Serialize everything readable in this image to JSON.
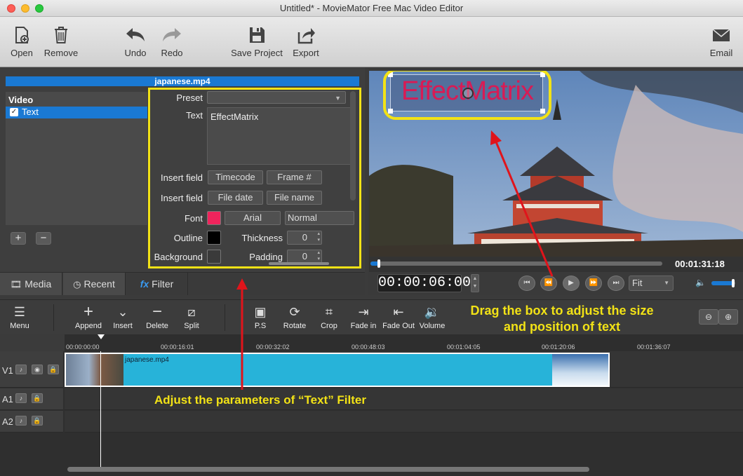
{
  "window": {
    "title": "Untitled* - MovieMator Free Mac Video Editor"
  },
  "toolbar": {
    "open": "Open",
    "remove": "Remove",
    "undo": "Undo",
    "redo": "Redo",
    "save_project": "Save Project",
    "export": "Export",
    "email": "Email"
  },
  "filter_panel": {
    "file_name": "japanese.mp4",
    "list_header": "Video",
    "list_item": "Text",
    "preset_label": "Preset",
    "text_label": "Text",
    "text_value": "EffectMatrix",
    "insert_field_label": "Insert field",
    "timecode_button": "Timecode",
    "frame_button": "Frame #",
    "file_date_button": "File date",
    "file_name_button": "File name",
    "font_label": "Font",
    "font_color": "#f0245c",
    "font_family": "Arial",
    "font_style": "Normal",
    "outline_label": "Outline",
    "outline_color": "#000000",
    "thickness_label": "Thickness",
    "thickness_value": "0",
    "background_label": "Background",
    "padding_label": "Padding",
    "padding_value": "0",
    "add_button": "+",
    "remove_button": "−"
  },
  "tabs": {
    "media": "Media",
    "recent": "Recent",
    "filter": "Filter"
  },
  "preview": {
    "overlay_text": "EffectMatrix",
    "overlay_color": "#d81b55",
    "duration": "00:01:31:18",
    "timecode": "00:00:06:00",
    "zoom": "Fit",
    "scrub_position": 0.03,
    "volume_level": 0.9
  },
  "timeline_toolbar": {
    "menu": "Menu",
    "append": "Append",
    "insert": "Insert",
    "delete": "Delete",
    "split": "Split",
    "ps": "P.S",
    "rotate": "Rotate",
    "crop": "Crop",
    "fade_in": "Fade in",
    "fade_out": "Fade Out",
    "volume": "Volume"
  },
  "ruler_ticks": [
    "00:00:00:00",
    "00:00:16:01",
    "00:00:32:02",
    "00:00:48:03",
    "00:01:04:05",
    "00:01:20:06",
    "00:01:36:07"
  ],
  "tracks": {
    "v1": "V1",
    "a1": "A1",
    "a2": "A2",
    "clip_name": "japanese.mp4"
  },
  "annotations": {
    "drag_box": "Drag the box to adjust the size and position of text",
    "adjust_params": "Adjust the parameters of “Text” Filter"
  },
  "colors": {
    "accent": "#1a79d3",
    "annotation": "#f2e216",
    "arrow": "#e0141b",
    "clip": "#27b3d9"
  }
}
